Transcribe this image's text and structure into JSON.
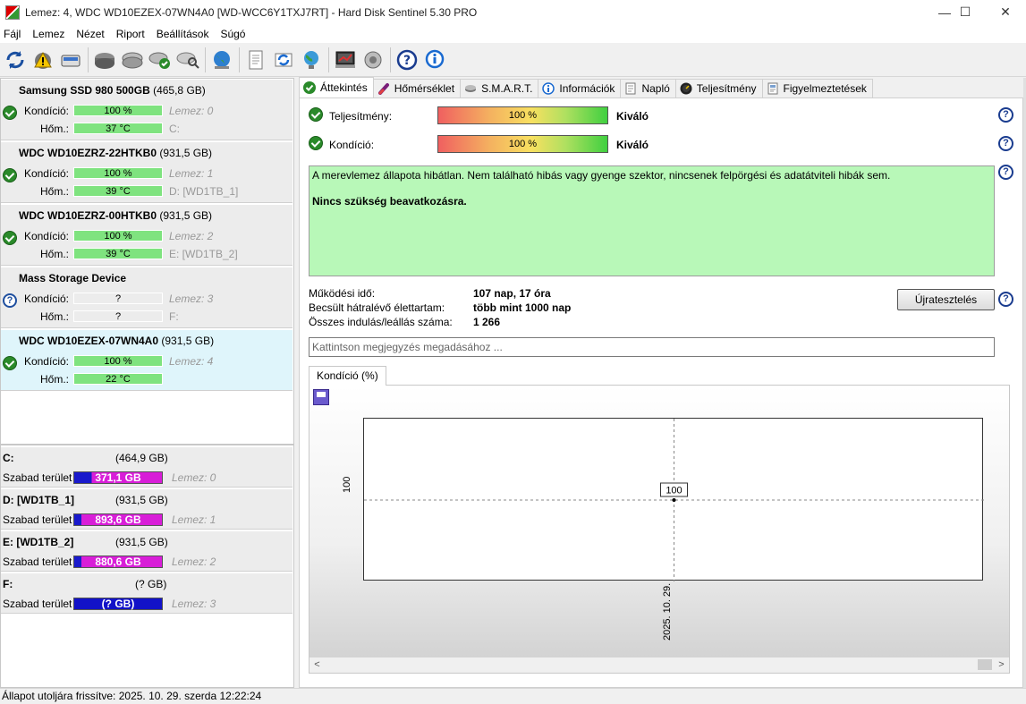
{
  "window": {
    "title": "Lemez: 4, WDC WD10EZEX-07WN4A0 [WD-WCC6Y1TXJ7RT]  -  Hard Disk Sentinel 5.30 PRO",
    "min": "—",
    "max": "☐",
    "close": "✕"
  },
  "menu": [
    "Fájl",
    "Lemez",
    "Nézet",
    "Riport",
    "Beállítások",
    "Súgó"
  ],
  "disks": [
    {
      "name": "Samsung SSD 980 500GB",
      "capacity": "(465,8 GB)",
      "cond_label": "Kondíció:",
      "health": "100 %",
      "disk_label": "Lemez: 0",
      "temp_label": "Hőm.:",
      "temp": "37 °C",
      "drive": "C:",
      "status": "ok"
    },
    {
      "name": "WDC WD10EZRZ-22HTKB0",
      "capacity": "(931,5 GB)",
      "cond_label": "Kondíció:",
      "health": "100 %",
      "disk_label": "Lemez: 1",
      "temp_label": "Hőm.:",
      "temp": "39 °C",
      "drive": "D: [WD1TB_1]",
      "status": "ok"
    },
    {
      "name": "WDC WD10EZRZ-00HTKB0",
      "capacity": "(931,5 GB)",
      "cond_label": "Kondíció:",
      "health": "100 %",
      "disk_label": "Lemez: 2",
      "temp_label": "Hőm.:",
      "temp": "39 °C",
      "drive": "E: [WD1TB_2]",
      "status": "ok"
    },
    {
      "name": "Mass   Storage Device",
      "capacity": "",
      "cond_label": "Kondíció:",
      "health": "?",
      "disk_label": "Lemez: 3",
      "temp_label": "Hőm.:",
      "temp": "?",
      "drive": "F:",
      "status": "unknown"
    },
    {
      "name": "WDC WD10EZEX-07WN4A0",
      "capacity": "(931,5 GB)",
      "cond_label": "Kondíció:",
      "health": "100 %",
      "disk_label": "Lemez: 4",
      "temp_label": "Hőm.:",
      "temp": "22 °C",
      "drive": "",
      "status": "ok"
    }
  ],
  "volumes": [
    {
      "name": "C:",
      "capacity": "(464,9 GB)",
      "free_label": "Szabad terület",
      "free": "371,1 GB",
      "disk": "Lemez: 0"
    },
    {
      "name": "D: [WD1TB_1]",
      "capacity": "(931,5 GB)",
      "free_label": "Szabad terület",
      "free": "893,6 GB",
      "disk": "Lemez: 1"
    },
    {
      "name": "E: [WD1TB_2]",
      "capacity": "(931,5 GB)",
      "free_label": "Szabad terület",
      "free": "880,6 GB",
      "disk": "Lemez: 2"
    },
    {
      "name": "F:",
      "capacity": "(? GB)",
      "free_label": "Szabad terület",
      "free": "(? GB)",
      "disk": "Lemez: 3"
    }
  ],
  "tabs": [
    "Áttekintés",
    "Hőmérséklet",
    "S.M.A.R.T.",
    "Információk",
    "Napló",
    "Teljesítmény",
    "Figyelmeztetések"
  ],
  "overview": {
    "perf_label": "Teljesítmény:",
    "perf_value": "100 %",
    "perf_text": "Kiváló",
    "cond_label": "Kondíció:",
    "cond_value": "100 %",
    "cond_text": "Kiváló",
    "message": "A merevlemez állapota hibátlan. Nem található hibás vagy gyenge szektor, nincsenek felpörgési és adatátviteli hibák sem.",
    "message_bold": "Nincs szükség beavatkozásra.",
    "uptime_label": "Működési idő:",
    "uptime": "107 nap, 17 óra",
    "remaining_label": "Becsült hátralévő élettartam:",
    "remaining": "több mint 1000 nap",
    "starts_label": "Összes indulás/leállás száma:",
    "starts": "1 266",
    "retest_button": "Újratesztelés",
    "note_placeholder": "Kattintson megjegyzés megadásához ..."
  },
  "chart_data": {
    "type": "line",
    "tab_label": "Kondíció  (%)",
    "x": [
      "2025. 10. 29."
    ],
    "series": [
      {
        "values": [
          100
        ]
      }
    ],
    "y_tick": "100",
    "point_label": "100",
    "grid": true
  },
  "statusbar": "Állapot utoljára frissítve: 2025. 10. 29. szerda 12:22:24"
}
